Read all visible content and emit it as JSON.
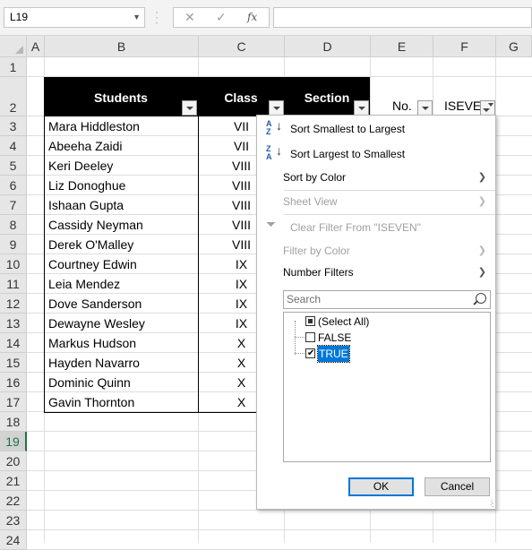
{
  "formula_bar": {
    "name_box": "L19",
    "cancel_glyph": "✕",
    "enter_glyph": "✓",
    "fx_glyph": "fx",
    "formula_value": ""
  },
  "columns": [
    "A",
    "B",
    "C",
    "D",
    "E",
    "F",
    "G"
  ],
  "rows": [
    "1",
    "2",
    "3",
    "4",
    "5",
    "6",
    "7",
    "8",
    "9",
    "10",
    "11",
    "12",
    "13",
    "14",
    "15",
    "16",
    "17",
    "18",
    "19",
    "20",
    "21",
    "22",
    "23",
    "24"
  ],
  "selected_row": "19",
  "table": {
    "headers": {
      "students": "Students",
      "class": "Class",
      "section": "Section",
      "no": "No.",
      "iseven": "ISEVEN"
    },
    "students": [
      "Mara Hiddleston",
      "Abeeha Zaidi",
      "Keri Deeley",
      "Liz Donoghue",
      "Ishaan Gupta",
      "Cassidy Neyman",
      "Derek O'Malley",
      "Courtney Edwin",
      "Leia Mendez",
      "Dove Sanderson",
      "Dewayne Wesley",
      "Markus Hudson",
      "Hayden Navarro",
      "Dominic Quinn",
      "Gavin Thornton"
    ],
    "classes": [
      "VII",
      "VII",
      "VIII",
      "VIII",
      "VIII",
      "VIII",
      "VIII",
      "IX",
      "IX",
      "IX",
      "IX",
      "X",
      "X",
      "X",
      "X"
    ]
  },
  "filter_menu": {
    "sort_asc": "Sort Smallest to Largest",
    "sort_desc": "Sort Largest to Smallest",
    "sort_by_color": "Sort by Color",
    "sheet_view": "Sheet View",
    "clear_filter": "Clear Filter From \"ISEVEN\"",
    "filter_by_color": "Filter by Color",
    "number_filters": "Number Filters",
    "search_placeholder": "Search",
    "items": [
      {
        "label": "(Select All)",
        "state": "partial"
      },
      {
        "label": "FALSE",
        "state": "unchecked"
      },
      {
        "label": "TRUE",
        "state": "checked"
      }
    ],
    "ok_label": "OK",
    "cancel_label": "Cancel"
  },
  "colors": {
    "excel_green": "#217346",
    "highlight": "#0078d7",
    "header_black": "#000000"
  }
}
